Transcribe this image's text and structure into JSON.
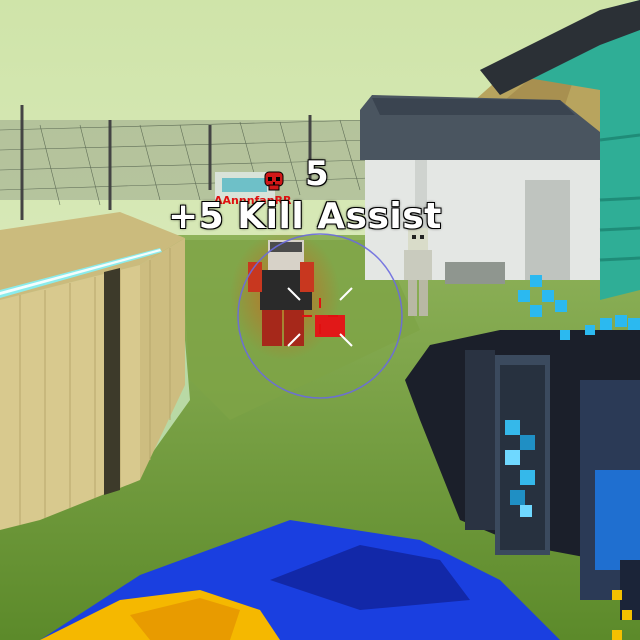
{
  "hud": {
    "kill_count": "5",
    "kill_assist_text": "+5 Kill Assist",
    "enemy_name": "AAnnnfanRR",
    "skull_icon": "skull-icon",
    "crosshair_icon": "crosshair-icon"
  },
  "colors": {
    "sky": "#c9e3a7",
    "grass": "#6f9a3c",
    "fence": "#d8c98e",
    "house_wall": "#e6e8e6",
    "house_trim": "#3fb39a",
    "roof": "#4b5560",
    "laser": "#6ff0ff",
    "weapon_blue": "#1a3be0",
    "weapon_yellow": "#f5b800",
    "enemy_highlight": "#ff2a00",
    "crosshair": "#6a6adf",
    "skull": "#d01818"
  }
}
